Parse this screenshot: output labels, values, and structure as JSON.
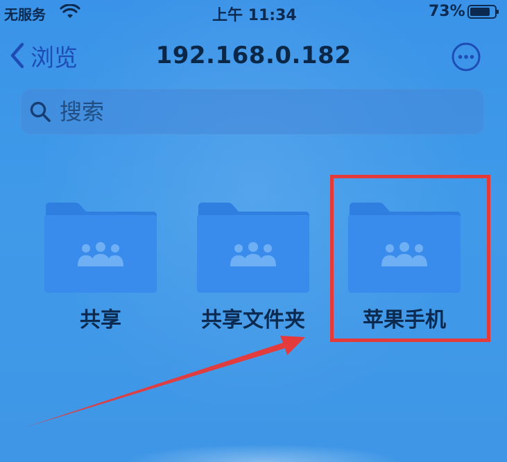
{
  "status_bar": {
    "carrier": "无服务",
    "time": "上午 11:34",
    "battery": "73%"
  },
  "nav": {
    "back_label": "浏览",
    "title": "192.168.0.182"
  },
  "search": {
    "placeholder": "搜索",
    "value": ""
  },
  "folders": [
    {
      "label": "共享",
      "icon": "shared-folder-icon"
    },
    {
      "label": "共享文件夹",
      "icon": "shared-folder-icon"
    },
    {
      "label": "苹果手机",
      "icon": "shared-folder-icon"
    }
  ],
  "colors": {
    "accent": "#1d4db4",
    "folder": "#2f7fe0",
    "highlight": "#e53a3a"
  }
}
